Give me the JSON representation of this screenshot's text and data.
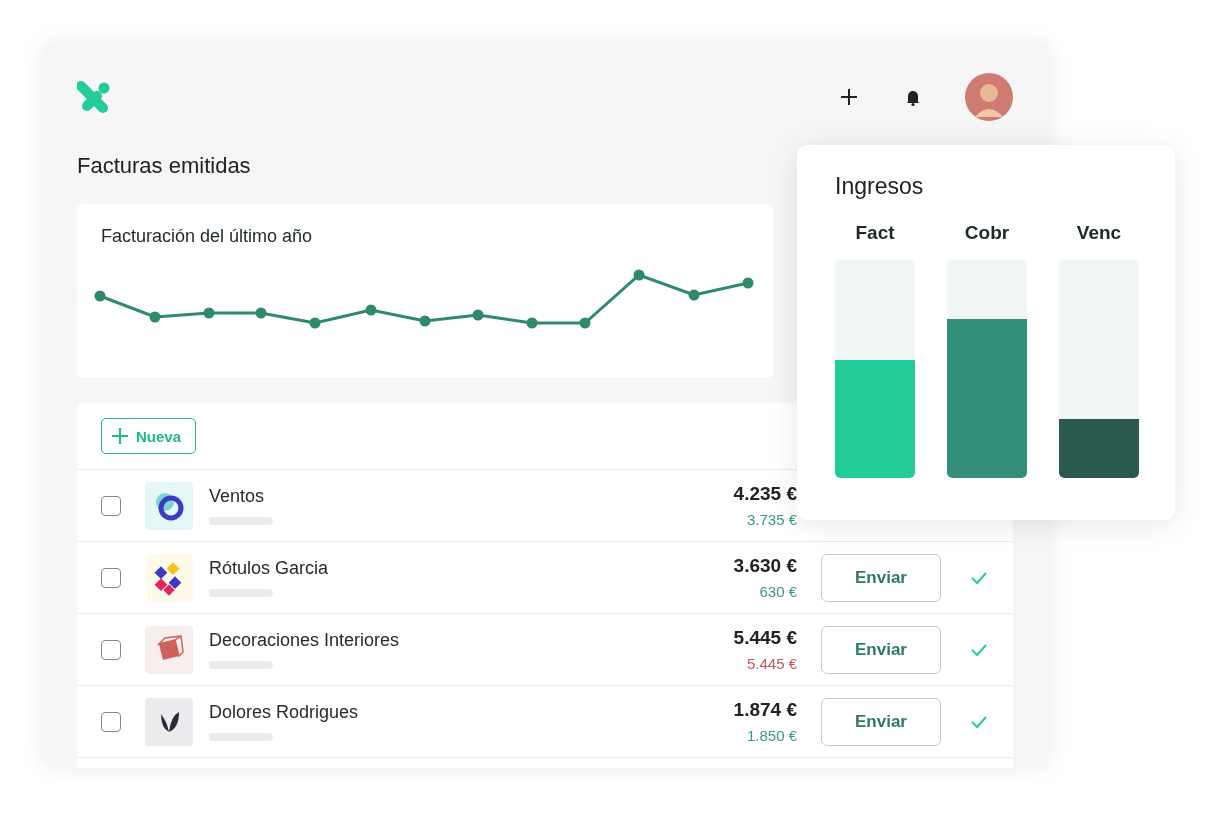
{
  "page": {
    "title": "Facturas emitidas"
  },
  "chart_card": {
    "title": "Facturación del último año"
  },
  "toolbar": {
    "new_button": "Nueva"
  },
  "invoices": [
    {
      "name": "Ventos",
      "total": "4.235 €",
      "paid": "3.735 €",
      "overdue": false,
      "checked": false
    },
    {
      "name": "Rótulos Garcia",
      "total": "3.630 €",
      "paid": "630 €",
      "overdue": false,
      "checked": false,
      "action": "Enviar",
      "sent": true
    },
    {
      "name": "Decoraciones Interiores",
      "total": "5.445 €",
      "paid": "5.445 €",
      "overdue": true,
      "checked": false,
      "action": "Enviar",
      "sent": true
    },
    {
      "name": "Dolores Rodrigues",
      "total": "1.874 €",
      "paid": "1.850 €",
      "overdue": false,
      "checked": false,
      "action": "Enviar",
      "sent": true
    }
  ],
  "income_panel": {
    "title": "Ingresos",
    "bars": [
      {
        "label": "Fact",
        "level": 0.54,
        "color": "#22cc99"
      },
      {
        "label": "Cobr",
        "level": 0.73,
        "color": "#338f7a"
      },
      {
        "label": "Venc",
        "level": 0.27,
        "color": "#2d5a4f"
      }
    ]
  }
}
